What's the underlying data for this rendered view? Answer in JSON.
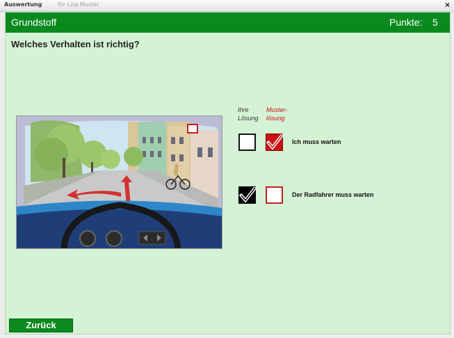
{
  "window": {
    "title_bold": "Auswertung",
    "title_rest": "für Lisa Muster",
    "close_glyph": "×"
  },
  "header": {
    "title": "Grundstoff",
    "points_label": "Punkte:",
    "points_value": "5",
    "bg_color": "#0a8a1e"
  },
  "question": "Welches Verhalten ist richtig?",
  "columns": {
    "ihre": "Ihre\nLösung",
    "muster": "Muster-\nlösung"
  },
  "answers": [
    {
      "label": "Ich muss warten",
      "user_selected": false,
      "correct": true
    },
    {
      "label": "Der Radfahrer muss warten",
      "user_selected": true,
      "correct": false
    }
  ],
  "back_button": "Zurück",
  "scene_icon": "traffic-scene-illustration",
  "colors": {
    "background": "#d4f2d4",
    "wrong_red": "#cc1111"
  }
}
